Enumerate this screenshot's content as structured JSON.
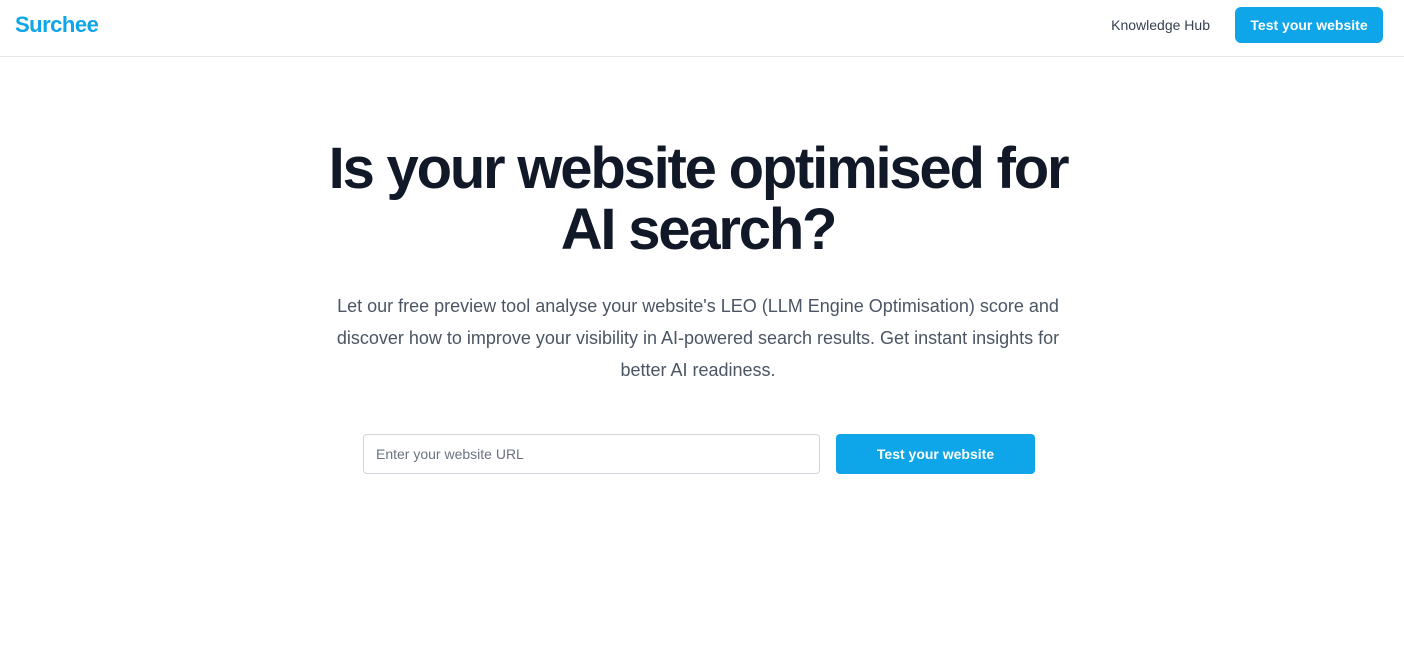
{
  "header": {
    "logo": "Surchee",
    "nav_link": "Knowledge Hub",
    "cta_label": "Test your website"
  },
  "hero": {
    "title_line1": "Is your website optimised for",
    "title_line2": "AI search?",
    "subtitle": "Let our free preview tool analyse your website's LEO (LLM Engine Optimisation) score and discover how to improve your visibility in AI-powered search results. Get instant insights for better AI readiness."
  },
  "form": {
    "url_value": "",
    "url_placeholder": "Enter your website URL",
    "submit_label": "Test your website"
  },
  "colors": {
    "brand": "#0ea5e9",
    "heading": "#111827",
    "body_text": "#4b5563"
  }
}
